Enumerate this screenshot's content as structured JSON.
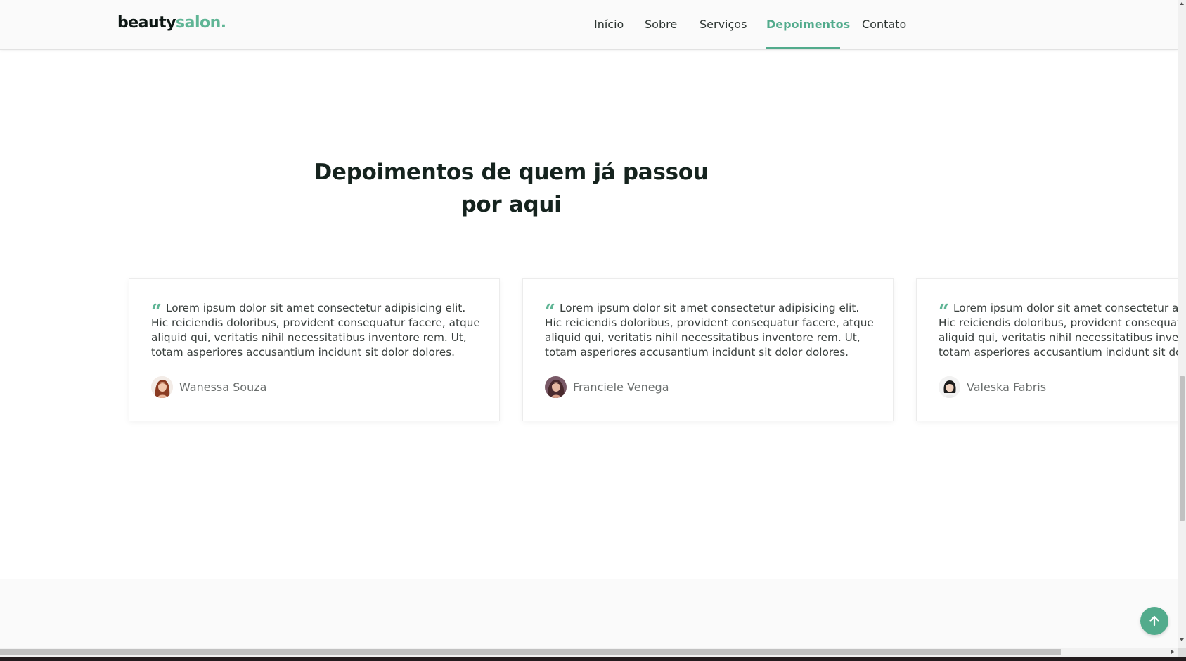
{
  "header": {
    "logo_part1": "beauty",
    "logo_part2": "salon.",
    "nav": [
      {
        "label": "Início",
        "active": false
      },
      {
        "label": "Sobre",
        "active": false
      },
      {
        "label": "Serviços",
        "active": false
      },
      {
        "label": "Depoimentos",
        "active": true
      },
      {
        "label": "Contato",
        "active": false
      }
    ]
  },
  "testimonials": {
    "title": "Depoimentos de quem já passou por aqui",
    "quote_mark": "“",
    "items": [
      {
        "text": "Lorem ipsum dolor sit amet consectetur adipisicing elit. Hic reiciendis doloribus, provident consequatur facere, atque aliquid qui, veritatis nihil necessitatibus inventore rem. Ut, totam asperiores accusantium incidunt sit dolor dolores.",
        "author": "Wanessa Souza",
        "avatar_icon": "woman-avatar-icon"
      },
      {
        "text": "Lorem ipsum dolor sit amet consectetur adipisicing elit. Hic reiciendis doloribus, provident consequatur facere, atque aliquid qui, veritatis nihil necessitatibus inventore rem. Ut, totam asperiores accusantium incidunt sit dolor dolores.",
        "author": "Franciele Venega",
        "avatar_icon": "woman-avatar-icon"
      },
      {
        "text": "Lorem ipsum dolor sit amet consectetur adipisicing elit. Hic reiciendis doloribus, provident consequatur facere, atque aliquid qui, veritatis nihil necessitatibus inventore rem. Ut, totam asperiores accusantium incidunt sit dolor dolores.",
        "author": "Valeska Fabris",
        "avatar_icon": "woman-avatar-icon"
      }
    ]
  },
  "back_to_top": {
    "icon": "arrow-up-icon"
  },
  "colors": {
    "accent": "#52ab8c",
    "logo_accent": "#5fb595",
    "heading": "#15231e",
    "body_text": "#3a403e"
  }
}
